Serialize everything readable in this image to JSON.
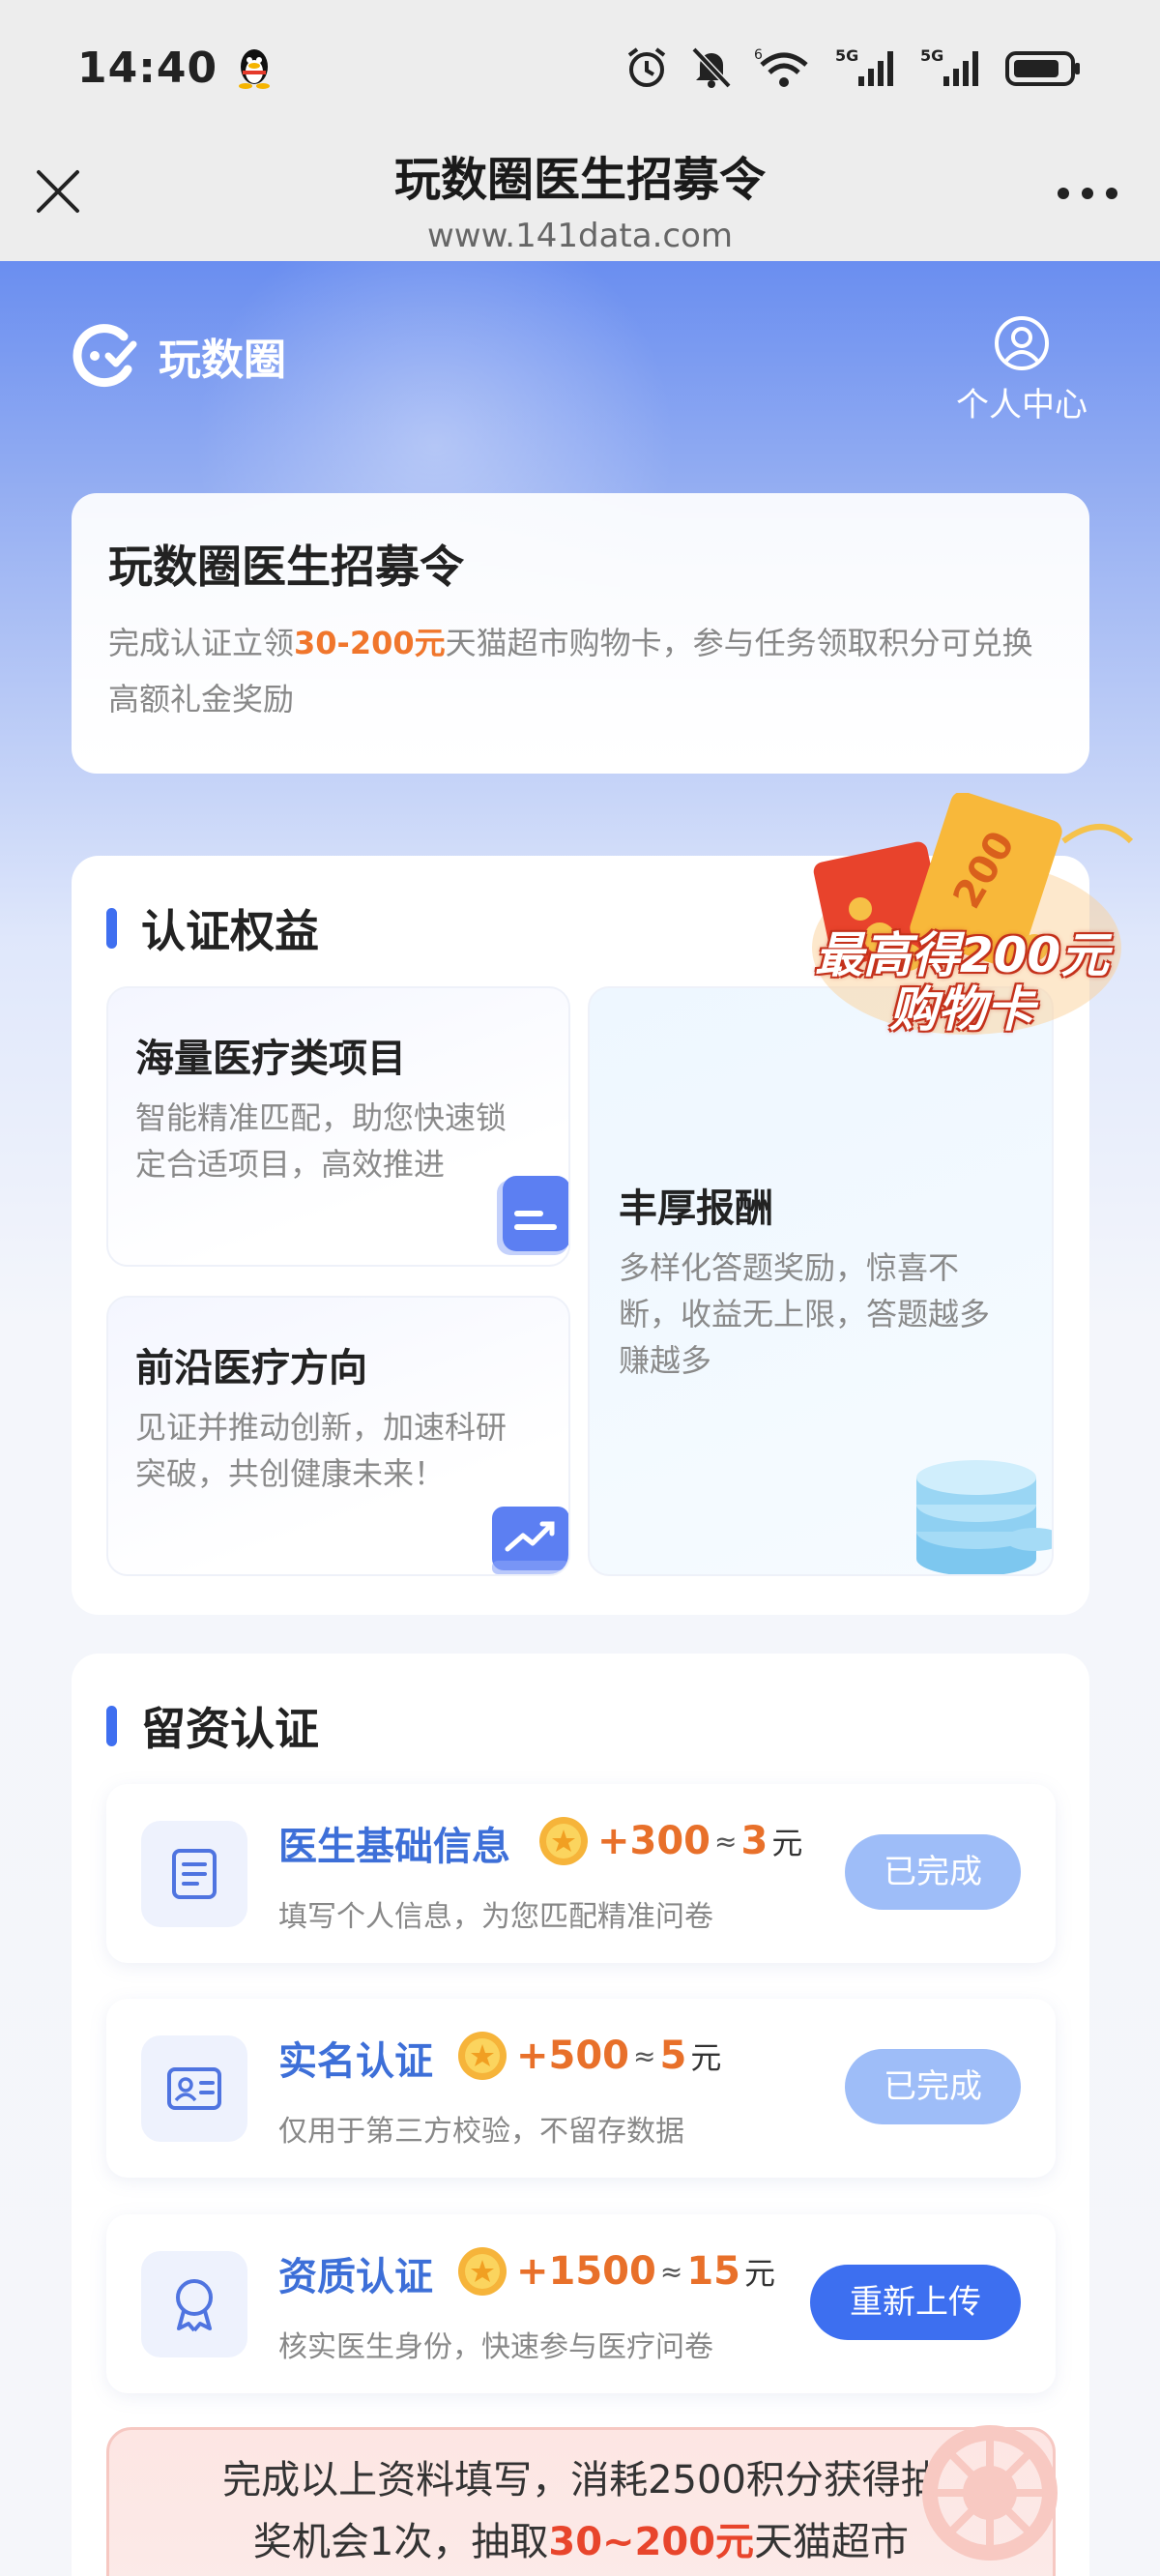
{
  "status_bar": {
    "time": "14:40"
  },
  "nav": {
    "title": "玩数圈医生招募令",
    "url": "www.141data.com"
  },
  "brand": {
    "name": "玩数圈",
    "user_center_label": "个人中心"
  },
  "intro": {
    "title": "玩数圈医生招募令",
    "desc_before": "完成认证立领",
    "desc_highlight": "30-200元",
    "desc_after": "天猫超市购物卡，参与任务领取积分可兑换高额礼金奖励"
  },
  "benefits": {
    "section_title": "认证权益",
    "promo_line1": "最高得200元",
    "promo_line2": "购物卡",
    "items": [
      {
        "title": "海量医疗类项目",
        "desc": "智能精准匹配，助您快速锁定合适项目，高效推进"
      },
      {
        "title": "前沿医疗方向",
        "desc": "见证并推动创新，加速科研突破，共创健康未来！"
      },
      {
        "title": "丰厚报酬",
        "desc": "多样化答题奖励，惊喜不断，收益无上限，答题越多赚越多"
      }
    ]
  },
  "cert": {
    "section_title": "留资认证",
    "approx": "≈",
    "unit": "元",
    "tasks": [
      {
        "title": "医生基础信息",
        "points": "+300",
        "yuan": "3",
        "desc": "填写个人信息，为您匹配精准问卷",
        "button": "已完成",
        "icon": "document-icon"
      },
      {
        "title": "实名认证",
        "points": "+500",
        "yuan": "5",
        "desc": "仅用于第三方校验，不留存数据",
        "button": "已完成",
        "icon": "id-card-icon"
      },
      {
        "title": "资质认证",
        "points": "+1500",
        "yuan": "15",
        "desc": "核实医生身份，快速参与医疗问卷",
        "button": "重新上传",
        "icon": "badge-icon"
      }
    ],
    "notice_before": "完成以上资料填写，消耗2500积分获得抽奖机会1次，抽取",
    "notice_highlight": "30~200元",
    "notice_after": "天猫超市"
  },
  "colors": {
    "accent": "#3d6ff0",
    "highlight_orange": "#f0762c",
    "done_button": "#9ebdf8"
  }
}
